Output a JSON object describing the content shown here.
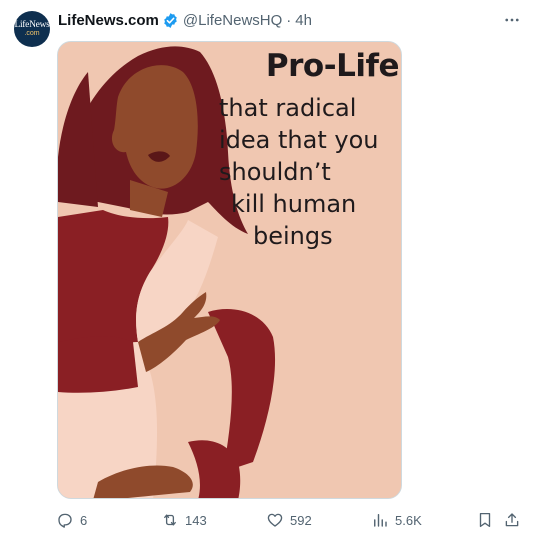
{
  "account": {
    "avatar_text_top": "LifeNews",
    "avatar_text_bottom": ".com",
    "display_name": "LifeNews.com",
    "handle": "@LifeNewsHQ",
    "separator": "·",
    "time": "4h"
  },
  "poster": {
    "title": "Pro-Life",
    "lines": [
      "that radical",
      "idea that you",
      "shouldn’t",
      "kill human",
      "beings"
    ],
    "colors": {
      "background": "#f0c7b1",
      "hair": "#6e1a1f",
      "skin": "#8f4a2c",
      "garment": "#8a1f24"
    }
  },
  "actions": {
    "reply_count": "6",
    "repost_count": "143",
    "like_count": "592",
    "views_count": "5.6K"
  },
  "icons": [
    "verified-badge-icon",
    "more-icon",
    "reply-icon",
    "repost-icon",
    "like-icon",
    "views-icon",
    "bookmark-icon",
    "share-icon"
  ],
  "colors": {
    "text_primary": "#0f1419",
    "text_secondary": "#536471",
    "verified": "#1d9bf0"
  }
}
